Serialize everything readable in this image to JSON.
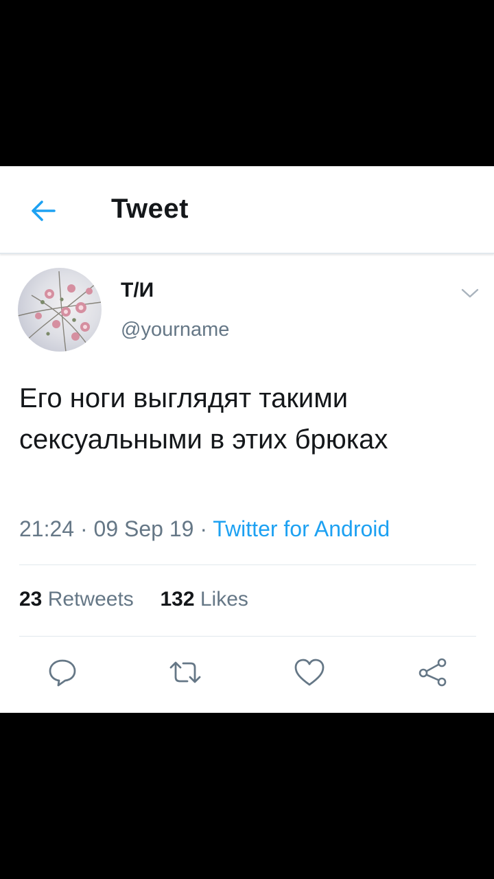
{
  "header": {
    "title": "Tweet",
    "back_icon": "arrow-left-icon"
  },
  "tweet": {
    "display_name": "Т/И",
    "handle": "@yourname",
    "text": "Его ноги выглядят такими сексуальными в этих брюках",
    "time": "21:24",
    "date": "09 Sep 19",
    "source": "Twitter for Android",
    "retweet_count": "23",
    "retweet_label": "Retweets",
    "like_count": "132",
    "like_label": "Likes"
  },
  "actions": {
    "reply_icon": "reply-icon",
    "retweet_icon": "retweet-icon",
    "like_icon": "heart-icon",
    "share_icon": "share-icon"
  },
  "colors": {
    "accent": "#1da1f2",
    "text_primary": "#14171a",
    "text_secondary": "#657786",
    "divider": "#e1e8ed"
  }
}
